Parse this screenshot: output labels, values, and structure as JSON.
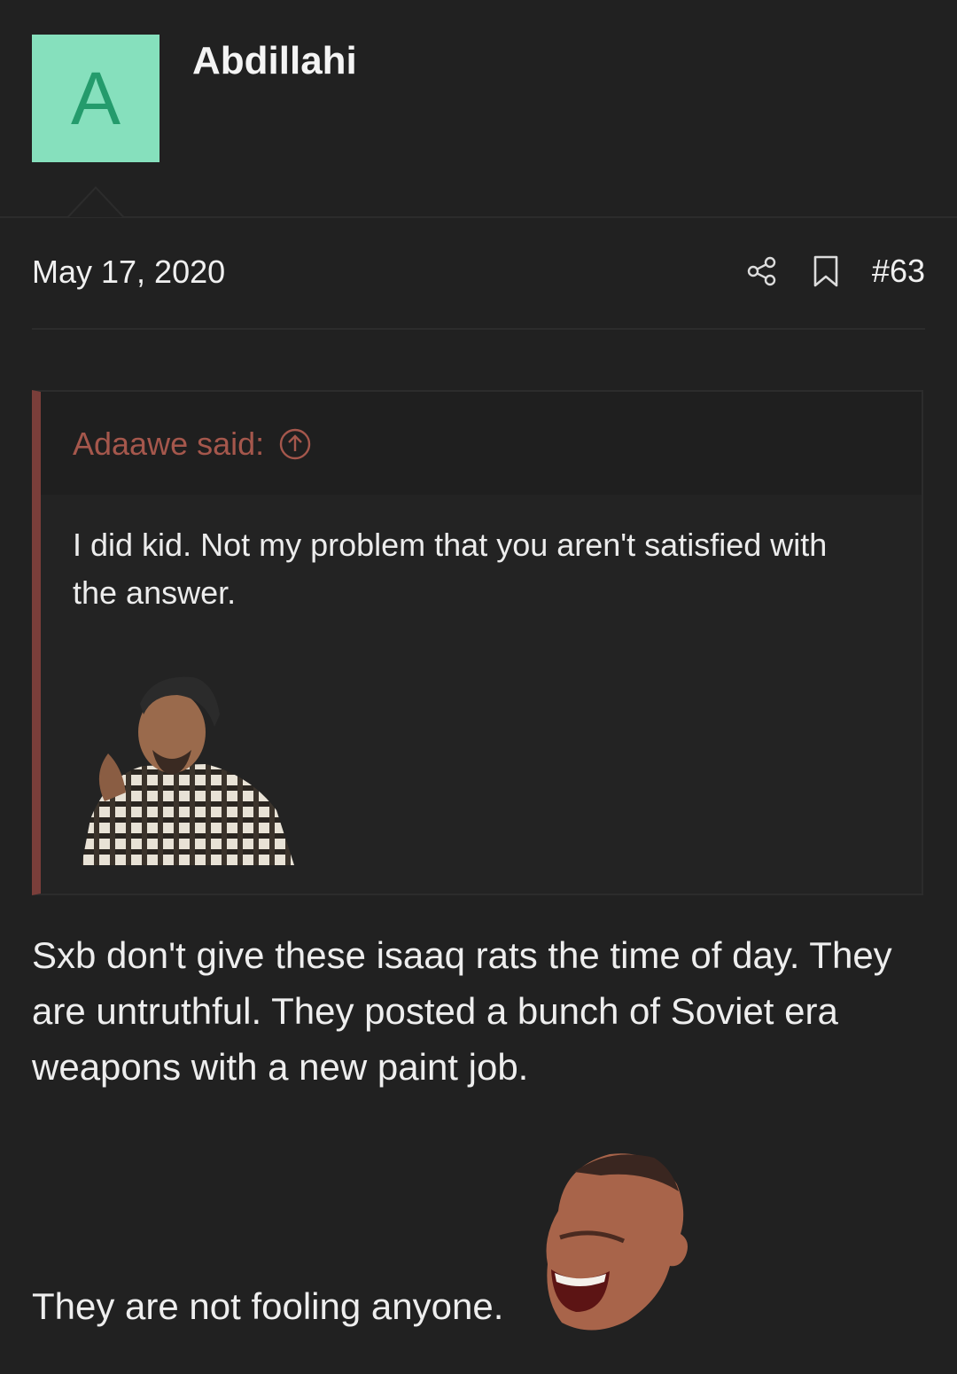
{
  "user": {
    "avatar_letter": "A",
    "name": "Abdillahi"
  },
  "post": {
    "date": "May 17, 2020",
    "number": "#63",
    "icons": [
      "share-icon",
      "bookmark-icon"
    ]
  },
  "quote": {
    "author_label": "Adaawe said:",
    "text": "I did kid. Not my problem that you aren't satisfied with the answer."
  },
  "body": {
    "paragraph": "Sxb don't give these isaaq rats the time of day. They are untruthful. They posted a bunch of Soviet era weapons with a new paint job.",
    "closing": "They are not fooling anyone."
  },
  "colors": {
    "background": "#212121",
    "avatar_bg": "#86e0bd",
    "avatar_letter": "#249b6c",
    "quote_accent": "#7a3e3a",
    "quote_author": "#a5574c"
  }
}
